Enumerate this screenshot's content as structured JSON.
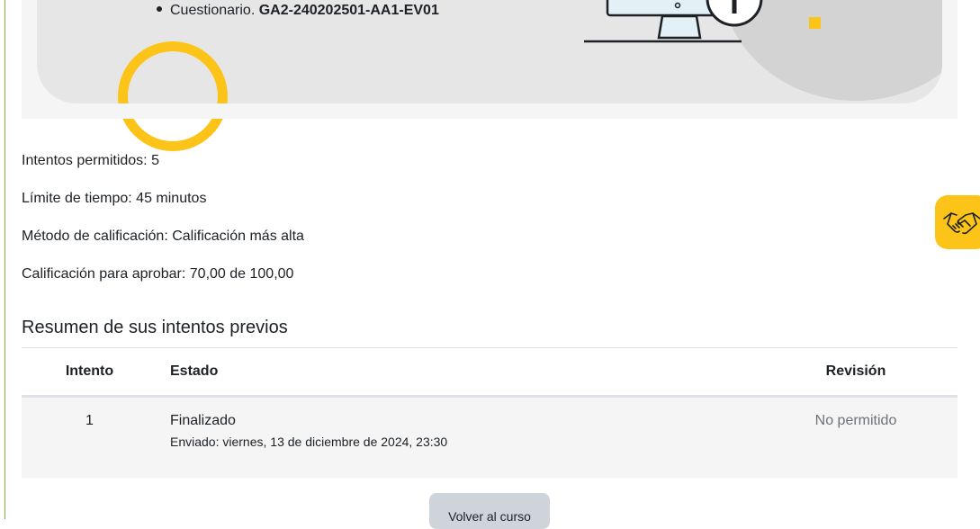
{
  "banner": {
    "item_prefix": "Cuestionario.",
    "item_code": "GA2-240202501-AA1-EV01"
  },
  "quiz_info": {
    "attempts": "Intentos permitidos: 5",
    "time_limit": "Límite de tiempo: 45 minutos",
    "grading_method": "Método de calificación: Calificación más alta",
    "pass_grade": "Calificación para aprobar: 70,00 de 100,00"
  },
  "summary": {
    "title": "Resumen de sus intentos previos",
    "headers": {
      "attempt": "Intento",
      "state": "Estado",
      "review": "Revisión"
    },
    "rows": [
      {
        "attempt": "1",
        "state": "Finalizado",
        "submitted": "Enviado: viernes, 13 de diciembre de 2024, 23:30",
        "review": "No permitido"
      }
    ]
  },
  "actions": {
    "back": "Volver al curso"
  },
  "icons": {
    "help": "handshake-icon",
    "illustration": "computer-monitor-icon"
  },
  "colors": {
    "accent_yellow": "#fcc419",
    "border_green": "#7cb342",
    "button_gray": "#ced4da"
  }
}
